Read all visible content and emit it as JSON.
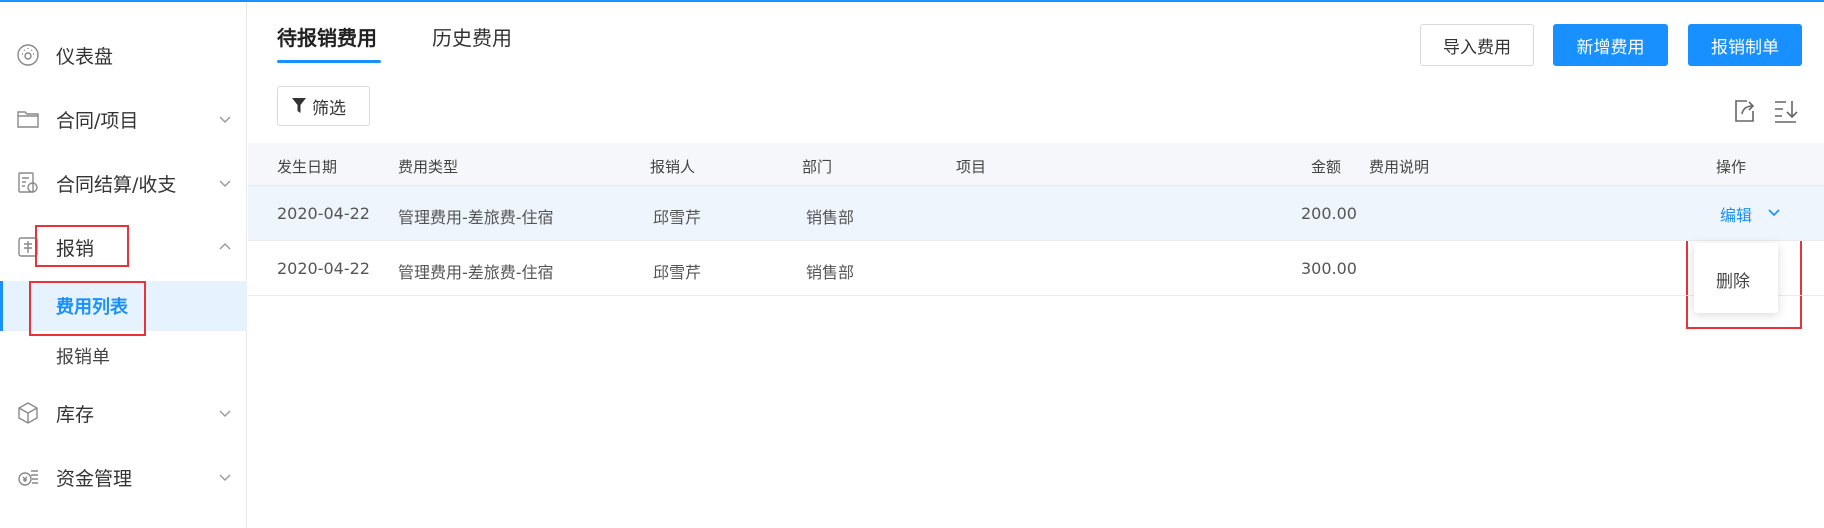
{
  "sidebar": {
    "items": [
      {
        "label": "仪表盘",
        "icon": "dashboard-icon"
      },
      {
        "label": "合同/项目",
        "icon": "folder-icon"
      },
      {
        "label": "合同结算/收支",
        "icon": "settlement-icon"
      },
      {
        "label": "报销",
        "icon": "reimburse-icon",
        "expanded": true,
        "children": [
          {
            "label": "费用列表",
            "active": true
          },
          {
            "label": "报销单"
          }
        ]
      },
      {
        "label": "库存",
        "icon": "cube-icon"
      },
      {
        "label": "资金管理",
        "icon": "fund-icon"
      }
    ]
  },
  "tabs": [
    {
      "label": "待报销费用",
      "active": true
    },
    {
      "label": "历史费用"
    }
  ],
  "actions": {
    "import": "导入费用",
    "add": "新增费用",
    "reimburse": "报销制单"
  },
  "filter": {
    "label": "筛选"
  },
  "table": {
    "headers": {
      "date": "发生日期",
      "type": "费用类型",
      "person": "报销人",
      "dept": "部门",
      "project": "项目",
      "amount": "金额",
      "desc": "费用说明",
      "ops": "操作"
    },
    "rows": [
      {
        "date": "2020-04-22",
        "type": "管理费用-差旅费-住宿",
        "person": "邱雪芹",
        "dept": "销售部",
        "project": "",
        "amount": "200.00",
        "desc": ""
      },
      {
        "date": "2020-04-22",
        "type": "管理费用-差旅费-住宿",
        "person": "邱雪芹",
        "dept": "销售部",
        "project": "",
        "amount": "300.00",
        "desc": ""
      }
    ],
    "edit_label": "编辑",
    "dropdown_items": [
      "删除"
    ]
  },
  "colors": {
    "accent": "#1890ff",
    "highlight": "#e8333b"
  }
}
